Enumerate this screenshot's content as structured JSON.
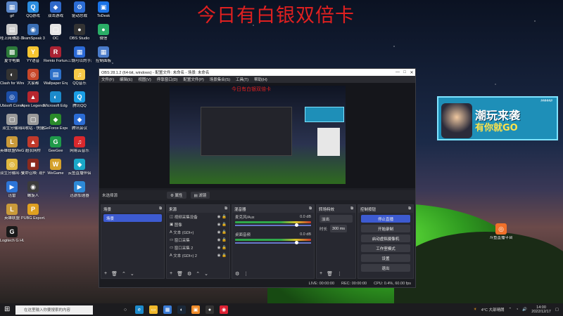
{
  "overlay_title": "今日有白银双倍卡",
  "desktop_icons": [
    {
      "label": "gif",
      "color": "#5b87c9",
      "glyph": "▦"
    },
    {
      "label": "QQ游戏",
      "color": "#2b8de0",
      "glyph": "Q"
    },
    {
      "label": "双击游戏",
      "color": "#3069c9",
      "glyph": "◆"
    },
    {
      "label": "驱动总裁",
      "color": "#2b6cd4",
      "glyph": "⚙"
    },
    {
      "label": "ToDesk",
      "color": "#1a73e8",
      "glyph": "▣"
    },
    {
      "label": "哇上网辅助-1118 - 快捷方式",
      "color": "#c9c9c9",
      "glyph": "▤"
    },
    {
      "label": "TeamSpeak 3",
      "color": "#3a6fb5",
      "glyph": "◉"
    },
    {
      "label": "OC",
      "color": "#e6e6e6",
      "glyph": "▢"
    },
    {
      "label": "OBS Studio",
      "color": "#333",
      "glyph": "●"
    },
    {
      "label": "微信",
      "color": "#2aae67",
      "glyph": "●"
    },
    {
      "label": "夏令电脑",
      "color": "#2d7a3a",
      "glyph": "▩"
    },
    {
      "label": "YY语音",
      "color": "#f6c531",
      "glyph": "Y"
    },
    {
      "label": "Remto Fortune ...",
      "color": "#a23",
      "glyph": "R"
    },
    {
      "label": "三锅可以的手游",
      "color": "#2c6ad6",
      "glyph": "▦"
    },
    {
      "label": "Clash for Windows...",
      "color": "#333",
      "glyph": "◐"
    },
    {
      "label": "大家都",
      "color": "#c8472a",
      "glyph": "◎"
    },
    {
      "label": "Wallpaper Engine: ...",
      "color": "#2d70c8",
      "glyph": "▤"
    },
    {
      "label": "QQ音乐",
      "color": "#f7c948",
      "glyph": "♫"
    },
    {
      "label": "控制面板",
      "color": "#4a7bc9",
      "glyph": "▦"
    },
    {
      "label": "Ubisoft Connect",
      "color": "#1c4fa8",
      "glyph": "◎"
    },
    {
      "label": "Apex Legends",
      "color": "#b8262e",
      "glyph": "▲"
    },
    {
      "label": "Microsoft Edge",
      "color": "#1c8acb",
      "glyph": "◐"
    },
    {
      "label": "腾讯QQ",
      "color": "#1a9ee6",
      "glyph": "Q"
    },
    {
      "label": "双生分输出",
      "color": "#9a9a9a",
      "glyph": "▢"
    },
    {
      "label": "回收站 - 快捷方式",
      "color": "#9a9a9a",
      "glyph": "▢"
    },
    {
      "label": "腾讯会议",
      "color": "#2b6cd4",
      "glyph": "◆"
    },
    {
      "label": "英雄联盟WeGame版",
      "color": "#c99a3a",
      "glyph": "L"
    },
    {
      "label": "超农网桥",
      "color": "#c0392b",
      "glyph": "▲"
    },
    {
      "label": "双生分输出-多地区网游...",
      "color": "#e0b840",
      "glyph": "◎"
    },
    {
      "label": "使命召唤: 现代战争 ...",
      "color": "#8a2a1e",
      "glyph": "◼"
    },
    {
      "label": "GeForce Experience",
      "color": "#2a8a2a",
      "glyph": "◆"
    },
    {
      "label": "网易云音乐",
      "color": "#d9282d",
      "glyph": "♫"
    },
    {
      "label": "迅雷",
      "color": "#2c75d8",
      "glyph": "▶"
    },
    {
      "label": "螺旋人",
      "color": "#3c3c3c",
      "glyph": "◉"
    },
    {
      "label": "GeeGee",
      "color": "#1f9a4a",
      "glyph": "G"
    },
    {
      "label": "云鱼直播伴侣",
      "color": "#1aa7c8",
      "glyph": "◆"
    },
    {
      "label": "英雄联盟",
      "color": "#c99a3a",
      "glyph": "L"
    },
    {
      "label": "PUBG Export...",
      "color": "#e0a020",
      "glyph": "P"
    },
    {
      "label": "WeGame",
      "color": "#d4a12a",
      "glyph": "W"
    },
    {
      "label": "迅游加速器",
      "color": "#2d8ad8",
      "glyph": "▶"
    },
    {
      "label": "Logitech G HUB",
      "color": "#1a1a1a",
      "glyph": "G"
    },
    {
      "label": "斗鱼直播平台",
      "color": "#f0702a",
      "glyph": "◎"
    }
  ],
  "obs": {
    "window_title": "OBS 28.1.2 (64-bit, windows) - 配置文件: 未命名 - 场景: 未命名",
    "menu": [
      "文件(F)",
      "编辑(E)",
      "视图(V)",
      "停靠窗口(D)",
      "配置文件(P)",
      "场景集合(S)",
      "工具(T)",
      "帮助(H)"
    ],
    "no_source_label": "未选择源",
    "properties_label": "属性",
    "filters_label": "滤镜",
    "preview_title": "今日有白银双倍卡",
    "scenes_panel": {
      "title": "场景",
      "items": [
        "场景"
      ]
    },
    "sources_panel": {
      "title": "来源",
      "items": [
        "视频采集设备",
        "图像",
        "文本 (GDI+)",
        "窗口采集",
        "窗口采集 2",
        "文本 (GDI+) 2"
      ]
    },
    "mixer_panel": {
      "title": "混音器",
      "channels": [
        {
          "name": "麦克风/Aux",
          "db": "0.0 dB"
        },
        {
          "name": "桌面音频",
          "db": "0.0 dB"
        }
      ]
    },
    "transitions_panel": {
      "title": "转场特效",
      "transition": "淡出",
      "duration_label": "时长",
      "duration_value": "300 ms"
    },
    "controls_panel": {
      "title": "控制按钮",
      "buttons": [
        "停止直播",
        "开始录制",
        "启动虚拟摄像机",
        "工作室模式",
        "设置",
        "退出"
      ]
    },
    "status": {
      "live": "LIVE: 00:00:00",
      "rec": "REC: 00:00:00",
      "cpu": "CPU: 0.4%, 60.00 fps"
    }
  },
  "banner": {
    "line1": "潮玩来袭",
    "line2": "有你就GO",
    "tag": "#4444#"
  },
  "taskbar": {
    "search_placeholder": "在这里输入你要搜索的内容",
    "weather": "4°C 大部晴朗",
    "time": "14:00",
    "date": "2022/12/17"
  }
}
